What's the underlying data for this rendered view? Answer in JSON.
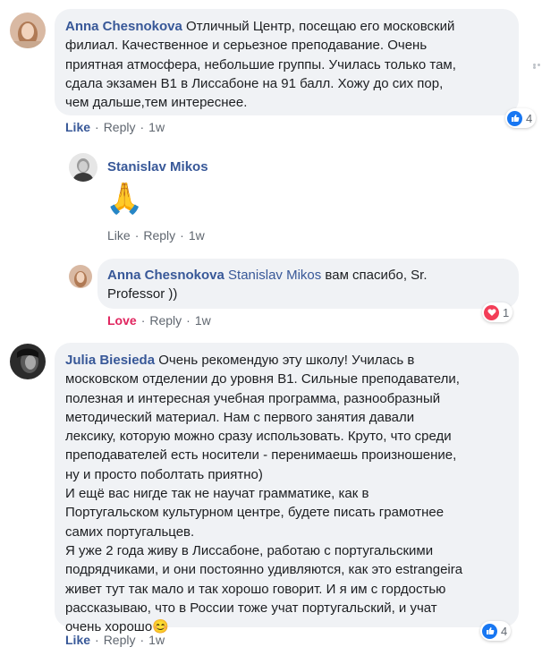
{
  "comments": [
    {
      "author": "Anna Chesnokova",
      "lines": [
        "Отличный Центр, посещаю его московский",
        "филиал. Качественное и серьезное преподавание. Очень",
        "приятная атмосфера, небольшие группы. Училась только там,",
        "сдала экзамен В1 в Лиссабоне на 91 балл. Хожу до сих пор,",
        "чем дальше,тем интереснее."
      ],
      "actions": {
        "like": "Like",
        "reply": "Reply",
        "time": "1w"
      },
      "reactions": {
        "count": "4",
        "icon": "like-reaction-icon",
        "color": "#1877f2"
      }
    },
    {
      "author": "Stanislav Mikos",
      "emoji": "🙏",
      "actions": {
        "like": "Like",
        "reply": "Reply",
        "time": "1w"
      }
    },
    {
      "author": "Anna Chesnokova",
      "mention": "Stanislav Mikos",
      "lines": [
        "вам спасибо, Sr.",
        "Professor ))"
      ],
      "actions": {
        "like": "Love",
        "reply": "Reply",
        "time": "1w"
      },
      "reactions": {
        "count": "1",
        "icon": "love-reaction-icon",
        "color": "#f33e58"
      }
    },
    {
      "author": "Julia Biesieda",
      "lines": [
        "Очень рекомендую эту школу! Училась в",
        "московском отделении до уровня В1. Сильные преподаватели,",
        "полезная и интересная учебная программа, разнообразный",
        "методический материал. Нам с первого занятия давали",
        "лексику, которую можно сразу использовать. Круто, что среди",
        "преподавателей есть носители - перенимаешь произношение,",
        "ну и просто поболтать приятно)",
        "И ещё вас нигде так не научат грамматике, как в",
        "Португальском культурном центре, будете писать грамотнее",
        "самих португальцев.",
        "Я уже 2 года живу в Лиссабоне, работаю с португальскими",
        "подрядчиками, и они постоянно удивляются, как это estrangeira",
        "живет тут так мало и так хорошо говорит. И я им с гордостью",
        "рассказываю, что в России тоже учат португальский, и учат",
        "очень хорошо"
      ],
      "emoji": "😊",
      "actions": {
        "like": "Like",
        "reply": "Reply",
        "time": "1w"
      },
      "reactions": {
        "count": "4",
        "icon": "like-reaction-icon",
        "color": "#1877f2"
      }
    }
  ],
  "menu": {
    "icon": "more-options-icon"
  }
}
